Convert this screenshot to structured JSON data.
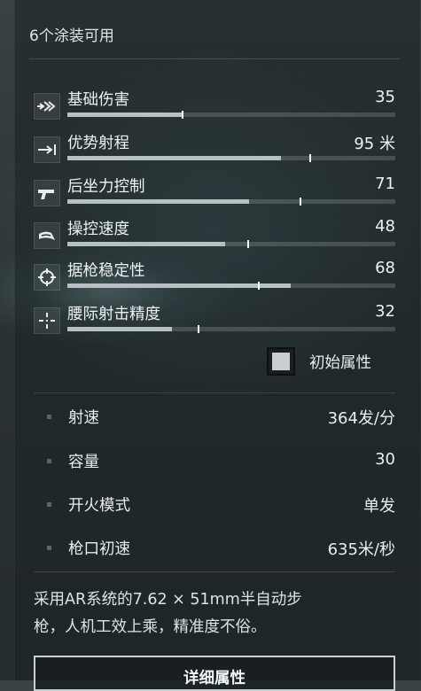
{
  "header": {
    "skins_available": "6个涂装可用"
  },
  "stats": [
    {
      "label": "基础伤害",
      "value": "35",
      "base": 0.35,
      "current": 0.35,
      "icon": "damage-icon"
    },
    {
      "label": "优势射程",
      "value": "95 米",
      "base": 0.65,
      "current": 0.74,
      "icon": "range-icon"
    },
    {
      "label": "后坐力控制",
      "value": "71",
      "base": 0.555,
      "current": 0.71,
      "icon": "recoil-control-icon"
    },
    {
      "label": "操控速度",
      "value": "48",
      "base": 0.48,
      "current": 0.55,
      "icon": "handling-speed-icon"
    },
    {
      "label": "据枪稳定性",
      "value": "68",
      "base": 0.68,
      "current": 0.585,
      "icon": "stability-icon"
    },
    {
      "label": "腰际射击精度",
      "value": "32",
      "base": 0.32,
      "current": 0.4,
      "icon": "hipfire-accuracy-icon"
    }
  ],
  "initial_attributes": {
    "label": "初始属性",
    "checked": true
  },
  "specs": [
    {
      "label": "射速",
      "value": "364发/分"
    },
    {
      "label": "容量",
      "value": "30"
    },
    {
      "label": "开火模式",
      "value": "单发"
    },
    {
      "label": "枪口初速",
      "value": "635米/秒"
    }
  ],
  "description_line1": "采用AR系统的7.62 × 51mm半自动步",
  "description_line2": "枪，人机工效上乘，精准度不俗。",
  "detail_button": {
    "label": "详细属性"
  }
}
